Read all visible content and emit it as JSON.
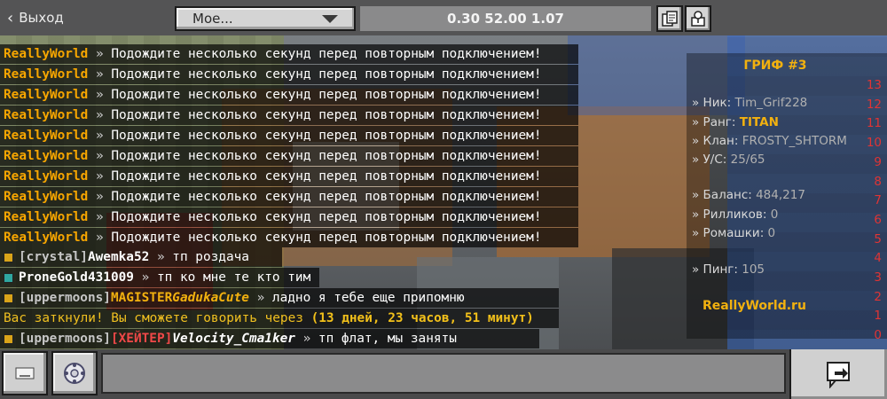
{
  "topbar": {
    "back_label": "Выход",
    "dropdown_value": "Мое...",
    "coords": "0.30  52.00  1.07",
    "icons": {
      "back": "chevron-left-icon",
      "copy": "copy-coordinates-icon",
      "share": "share-icon"
    }
  },
  "scoreboard": {
    "title": "ГРИФ #3",
    "nick_label": "» Ник:",
    "nick_value": "Tim_Grif228",
    "rank_label": "» Ранг:",
    "rank_value": "TITAN",
    "clan_label": "» Клан:",
    "clan_value": "FROSTY_SHTORM",
    "ks_label": "» У/С:",
    "ks_value": "25/65",
    "balance_label": "» Баланс:",
    "balance_value": "484,217",
    "rilliki_label": "» Рилликов:",
    "rilliki_value": "0",
    "romashki_label": "» Ромашки:",
    "romashki_value": "0",
    "ping_label": "» Пинг:",
    "ping_value": "105",
    "server": "ReallyWorld.ru",
    "score_numbers": [
      "13",
      "12",
      "11",
      "10",
      "9",
      "8",
      "7",
      "6",
      "5",
      "4",
      "3",
      "2",
      "1",
      "0"
    ]
  },
  "chat": {
    "server_tag": "ReallyWorld",
    "sep": " » ",
    "reconnect_msg": "Подождите несколько секунд перед повторным подключением!",
    "reconnect_count": 10,
    "crystal_clan": "[crystal]",
    "crystal_player": "Awemka52",
    "crystal_msg": "тп роздача",
    "prone_player": "ProneGold431009",
    "prone_msg": "тп ко мне те кто тим",
    "upper_clan": "[uppermoons]",
    "magister_rank": "MAGISTER",
    "magister_player": "GadukaCute",
    "magister_msg": "ладно я тебе еще припомню",
    "muted_prefix": "Вас заткнули! Вы сможете говорить через ",
    "muted_time": "(13 дней, 23 часов, 51 минут)",
    "hater_rank": "[ХЕЙТЕР]",
    "hater_player": "Velocity_Cma1ker",
    "hater_msg": "тп флат, мы заняты"
  },
  "bottombar": {
    "input_value": "",
    "icons": {
      "keyboard": "keyboard-icon",
      "emote": "emote-wheel-icon",
      "send": "send-message-icon"
    }
  },
  "colors": {
    "server_tag": "#f7a600",
    "scoreboard_title": "#f2b10f",
    "muted": "#f0c020"
  }
}
